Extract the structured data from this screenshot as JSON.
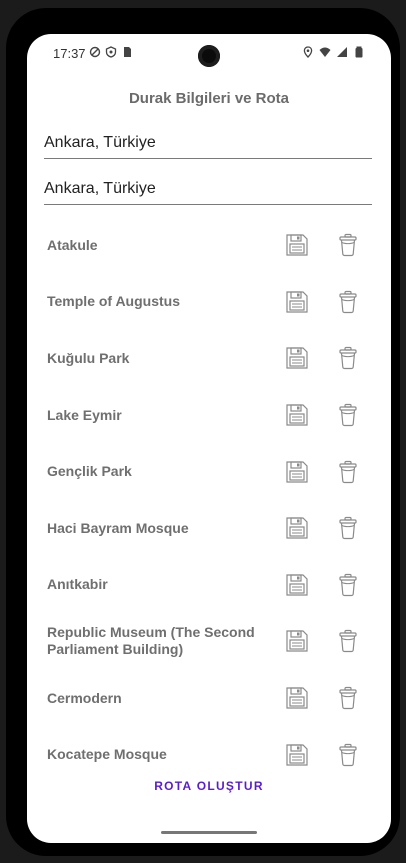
{
  "status_bar": {
    "time": "17:37"
  },
  "header": {
    "title": "Durak Bilgileri ve Rota"
  },
  "inputs": {
    "from_value": "Ankara, Türkiye",
    "to_value": "Ankara, Türkiye"
  },
  "stops": [
    {
      "name": "Atakule"
    },
    {
      "name": "Temple of Augustus"
    },
    {
      "name": "Kuğulu Park"
    },
    {
      "name": "Lake Eymir"
    },
    {
      "name": "Gençlik Park"
    },
    {
      "name": "Haci Bayram Mosque"
    },
    {
      "name": "Anıtkabir"
    },
    {
      "name": "Republic Museum (The Second Parliament Building)"
    },
    {
      "name": "Cermodern"
    },
    {
      "name": "Kocatepe Mosque"
    }
  ],
  "actions": {
    "create_route_label": "ROTA OLUŞTUR"
  },
  "colors": {
    "accent": "#5a1ec9",
    "label": "#6f6f6f",
    "icon": "#8a8a8a"
  },
  "icons": {
    "save": "floppy-disk-icon",
    "delete": "trash-can-icon"
  }
}
